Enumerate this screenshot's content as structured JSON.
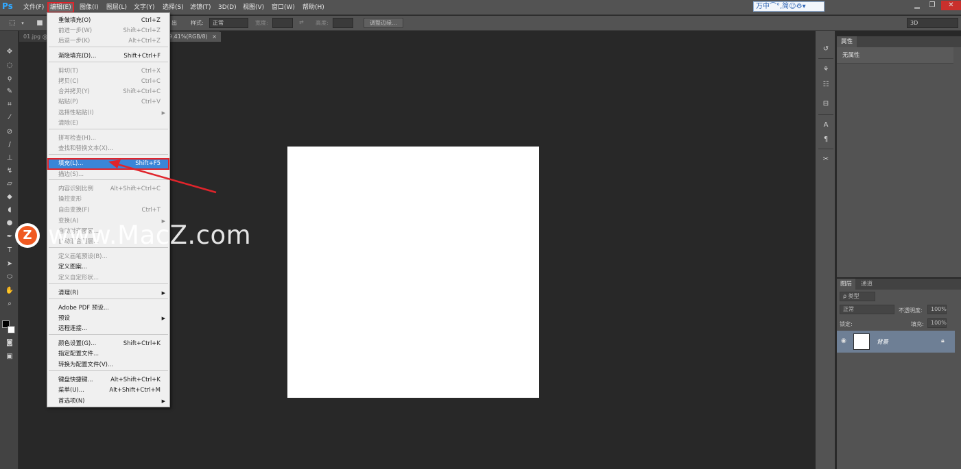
{
  "app": {
    "logo": "Ps",
    "menu_items": [
      "文件(F)",
      "编辑(E)",
      "图像(I)",
      "图层(L)",
      "文字(Y)",
      "选择(S)",
      "滤镜(T)",
      "3D(D)",
      "视图(V)",
      "窗口(W)",
      "帮助(H)"
    ],
    "active_menu": "编辑(E)",
    "ime_text": "万中⌒°,简☺⚙▾"
  },
  "options_bar": {
    "antialias_suffix": "出",
    "style_label": "样式:",
    "style_value": "正常",
    "width_label": "宽度:",
    "height_label": "高度:",
    "refine_edge_label": "调整边缘...",
    "workspace_value": "3D"
  },
  "doc_tabs": [
    {
      "label": "01.jpg @"
    },
    {
      "label": "9.41%(RGB/8)",
      "close": "×"
    }
  ],
  "edit_menu": {
    "items": [
      {
        "label": "重做填充(O)",
        "shortcut": "Ctrl+Z",
        "disabled": false
      },
      {
        "label": "前进一步(W)",
        "shortcut": "Shift+Ctrl+Z",
        "disabled": true
      },
      {
        "label": "后退一步(K)",
        "shortcut": "Alt+Ctrl+Z",
        "disabled": true
      },
      {
        "label": "渐隐填充(D)...",
        "shortcut": "Shift+Ctrl+F",
        "disabled": false
      },
      {
        "label": "剪切(T)",
        "shortcut": "Ctrl+X",
        "disabled": true
      },
      {
        "label": "拷贝(C)",
        "shortcut": "Ctrl+C",
        "disabled": true
      },
      {
        "label": "合并拷贝(Y)",
        "shortcut": "Shift+Ctrl+C",
        "disabled": true
      },
      {
        "label": "粘贴(P)",
        "shortcut": "Ctrl+V",
        "disabled": true
      },
      {
        "label": "选择性粘贴(I)",
        "shortcut": "",
        "submenu": true,
        "disabled": true
      },
      {
        "label": "清除(E)",
        "shortcut": "",
        "disabled": true
      },
      {
        "label": "拼写检查(H)...",
        "shortcut": "",
        "disabled": true
      },
      {
        "label": "查找和替换文本(X)...",
        "shortcut": "",
        "disabled": true
      },
      {
        "label": "填充(L)...",
        "shortcut": "Shift+F5",
        "disabled": false,
        "highlighted": true
      },
      {
        "label": "描边(S)...",
        "shortcut": "",
        "disabled": true
      },
      {
        "label": "内容识别比例",
        "shortcut": "Alt+Shift+Ctrl+C",
        "disabled": true
      },
      {
        "label": "操控变形",
        "shortcut": "",
        "disabled": true
      },
      {
        "label": "自由变换(F)",
        "shortcut": "Ctrl+T",
        "disabled": true
      },
      {
        "label": "变换(A)",
        "shortcut": "",
        "submenu": true,
        "disabled": true
      },
      {
        "label": "自动对齐图层...",
        "shortcut": "",
        "disabled": true
      },
      {
        "label": "自动混合图层...",
        "shortcut": "",
        "disabled": true
      },
      {
        "label": "定义画笔预设(B)...",
        "shortcut": "",
        "disabled": true
      },
      {
        "label": "定义图案...",
        "shortcut": "",
        "disabled": false
      },
      {
        "label": "定义自定形状...",
        "shortcut": "",
        "disabled": true
      },
      {
        "label": "清理(R)",
        "shortcut": "",
        "submenu": true,
        "disabled": false
      },
      {
        "label": "Adobe PDF 预设...",
        "shortcut": "",
        "disabled": false
      },
      {
        "label": "预设",
        "shortcut": "",
        "submenu": true,
        "disabled": false
      },
      {
        "label": "远程连接...",
        "shortcut": "",
        "disabled": false
      },
      {
        "label": "颜色设置(G)...",
        "shortcut": "Shift+Ctrl+K",
        "disabled": false
      },
      {
        "label": "指定配置文件...",
        "shortcut": "",
        "disabled": false
      },
      {
        "label": "转换为配置文件(V)...",
        "shortcut": "",
        "disabled": false
      },
      {
        "label": "键盘快捷键...",
        "shortcut": "Alt+Shift+Ctrl+K",
        "disabled": false
      },
      {
        "label": "菜单(U)...",
        "shortcut": "Alt+Shift+Ctrl+M",
        "disabled": false
      },
      {
        "label": "首选项(N)",
        "shortcut": "",
        "submenu": true,
        "disabled": false
      }
    ]
  },
  "watermark": {
    "badge": "Z",
    "text": "www.MacZ.com"
  },
  "properties_panel": {
    "tab": "属性",
    "body": "无属性"
  },
  "layers_panel": {
    "tabs": [
      "图层",
      "通道"
    ],
    "filter_kind": "ρ 类型",
    "blend_mode": "正常",
    "opacity_label": "不透明度:",
    "opacity_value": "100%",
    "lock_label": "锁定:",
    "fill_label": "填充:",
    "fill_value": "100%",
    "layer_name": "背景"
  },
  "colors": {
    "highlight_outline": "#e0242b",
    "menu_highlight": "#3a86d8",
    "annotation_arrow": "#e0242b"
  }
}
